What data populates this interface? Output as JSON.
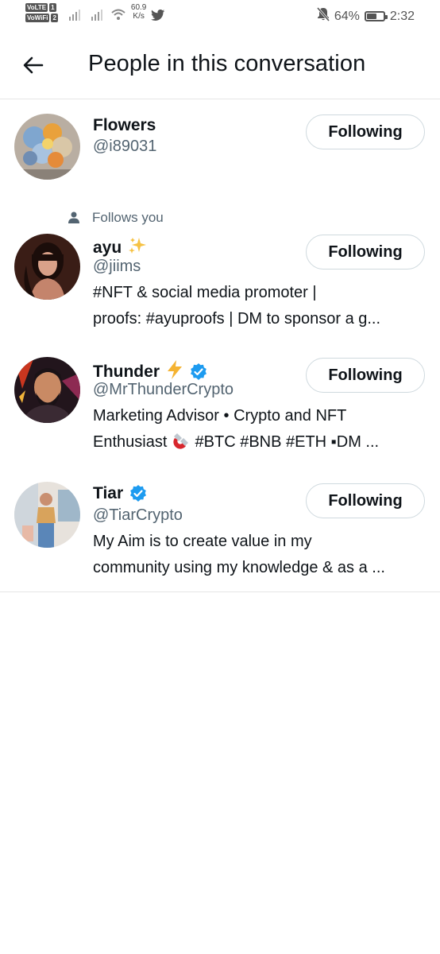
{
  "status_bar": {
    "volte_label": "VoLTE",
    "volte_slot": "1",
    "vowifi_label": "VoWiFi",
    "vowifi_slot": "2",
    "net_speed_value": "60.9",
    "net_speed_unit": "K/s",
    "battery_percent": "64%",
    "battery_level": 0.64,
    "time": "2:32"
  },
  "header": {
    "title": "People in this conversation",
    "back_icon": "arrow-left-icon"
  },
  "users": [
    {
      "name": "Flowers",
      "handle": "@i89031",
      "follows_you": "",
      "verified": false,
      "bio": [],
      "button": "Following"
    },
    {
      "name": "ayu",
      "name_emoji": "sparkles-icon",
      "handle": "@jiims",
      "follows_you": "Follows you",
      "verified": false,
      "bio": [
        "#NFT & social media promoter |",
        "proofs: #ayuproofs | DM to sponsor a g..."
      ],
      "button": "Following"
    },
    {
      "name": "Thunder",
      "name_emoji": "lightning-icon",
      "handle": "@MrThunderCrypto",
      "follows_you": "",
      "verified": true,
      "bio": [
        "Marketing Advisor • Crypto and NFT",
        "Enthusiast",
        "#BTC #BNB #ETH ▪DM ..."
      ],
      "button": "Following"
    },
    {
      "name": "Tiar",
      "handle": "@TiarCrypto",
      "follows_you": "",
      "verified": true,
      "bio": [
        "My Aim is to create value in my",
        "community using my knowledge & as a ..."
      ],
      "button": "Following"
    }
  ],
  "colors": {
    "text_primary": "#0f1419",
    "text_secondary": "#536471",
    "verified_blue": "#1d9bf0",
    "border": "#cfd9de"
  }
}
